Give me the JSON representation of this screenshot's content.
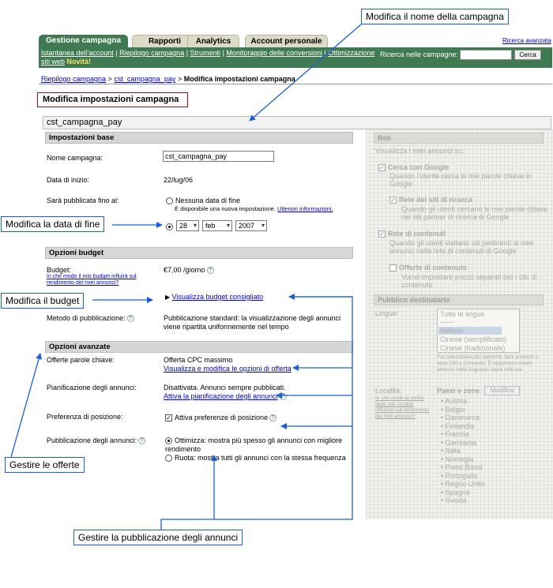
{
  "callouts": {
    "campaign_name": "Modifica il nome della campagna",
    "end_date": "Modifica la data di fine",
    "budget": "Modifica il budget",
    "offers": "Gestire le offerte",
    "ad_serving": "Gestire la pubblicazione degli annunci"
  },
  "tabs": [
    "Gestione campagna",
    "Rapporti",
    "Analytics",
    "Account personale"
  ],
  "advanced_search": "Ricerca avanzata",
  "nav": {
    "links": [
      "Istantanea dell'account",
      "Riepilogo campagna",
      "Strumenti",
      "Monitoraggio delle conversioni",
      "Ottimizzazione"
    ],
    "link_line2": "siti web",
    "new_badge": "Novità!",
    "search_label": "Ricerca nelle campagne:",
    "search_button": "Cerca"
  },
  "breadcrumb": {
    "crumb1": "Riepilogo campagna",
    "sep": ">",
    "crumb2": "cst_campagna_pay",
    "current": "Modifica impostazioni campagna"
  },
  "page_title": "Modifica impostazioni campagna",
  "campaign_bar": "cst_campagna_pay",
  "basic": {
    "title": "Impostazioni base",
    "name_label": "Nome campagna:",
    "name_value": "cst_campagna_pay",
    "start_label": "Data di inizio:",
    "start_value": "22/lug/06",
    "end_label": "Sarà pubblicata fino al:",
    "no_end": "Nessuna data di fine",
    "no_end_note": "È disponibile una nuova impostazione.",
    "more_info": "Ulteriori informazioni.",
    "day": "28",
    "month": "feb",
    "year": "2007"
  },
  "budget": {
    "title": "Opzioni budget",
    "label": "Budget:",
    "help_link": "In che modo il mio budget influirà sul rendimento dei miei annunci?",
    "value": "€7,00 /giorno",
    "recommended": "Visualizza budget consigliato",
    "method_label": "Metodo di pubblicazione:",
    "method_value": "Pubblicazione standard: la visualizzazione degli annunci viene ripartita uniformemente nel tempo"
  },
  "advanced": {
    "title": "Opzioni avanzate",
    "offers_label": "Offerte parole chiave:",
    "offers_value": "Offerta CPC massimo",
    "offers_link": "Visualizza e modifica le opzioni di offerta",
    "scheduling_label": "Pianificazione degli annunci:",
    "scheduling_value": "Disattivata. Annunci sempre pubblicati.",
    "scheduling_link": "Attiva la pianificazione degli annunci",
    "position_label": "Preferenza di posizione:",
    "position_value": "Attiva preferenze di posizione",
    "serving_label": "Pubblicazione degli annunci:",
    "serving_opt1": "Ottimizza: mostra più spesso gli annunci con migliore rendimento",
    "serving_opt2": "Ruota: mostra tutti gli annunci con la stessa frequenza"
  },
  "networks": {
    "title": "Reti",
    "intro": "Visualizza i miei annunci su:",
    "google": "Cerca con Google",
    "google_desc": "Quando l'utente cerca le mie parole chiave in Google",
    "search_net": "Rete dei siti di ricerca",
    "search_net_desc": "Quando gli utenti cercano le mie parole chiave nei siti partner di ricerca di Google",
    "content_net": "Rete di contenuti",
    "content_net_desc": "Quando gli utenti visitano siti pertinenti ai miei annunci nella rete di contenuti di Google",
    "content_offer": "Offerte di contenuto",
    "content_offer_desc": "Vorrei impostare prezzi separati per i clic di contenuto"
  },
  "audience": {
    "title": "Pubblico destinatario",
    "languages_label": "Lingue:",
    "languages": [
      "Tutte le lingue",
      "------",
      "Italiano",
      "Cinese (semplificato)",
      "Cinese (tradizionale)"
    ],
    "lang_note": "Per selezionare più elementi, tieni premuto il tasto Ctrl o Comando. È opportuno creare annunci nella lingua(e) sopra indicata.",
    "locations_label": "Località:",
    "locations_help": "In che modo la scelta delle mie località influisce sul rendimento dei miei annunci?",
    "countries_label": "Paesi e zone",
    "modify": "Modifica",
    "countries": [
      "Austria",
      "Belgio",
      "Danimarca",
      "Finlandia",
      "Francia",
      "Germania",
      "Italia",
      "Norvegia",
      "Paesi Bassi",
      "Portogallo",
      "Regno Unito",
      "Spagna",
      "Svezia"
    ]
  },
  "colors": {
    "accent_green": "#3f7a52",
    "callout_blue": "#1a5fd6",
    "title_border_red": "#cc0000",
    "link_blue": "#0000cc"
  }
}
